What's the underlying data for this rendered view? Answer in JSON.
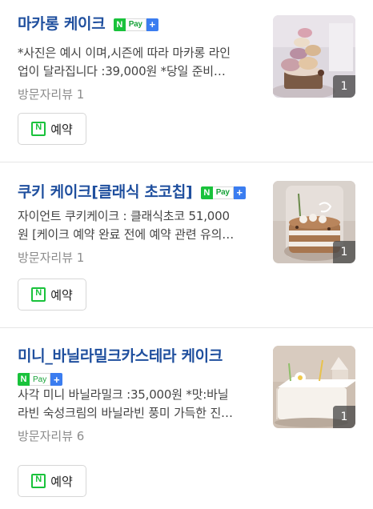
{
  "items": [
    {
      "title": "마카롱 케이크",
      "npay": {
        "n": "N",
        "pay": "Pay",
        "plus": "+"
      },
      "desc_line1": "*사진은 예시 이며,시즌에 따라 마카롱 라인",
      "desc_line2": "업이 달라집니다 :39,000원 *당일 준비…",
      "review": "방문자리뷰 1",
      "reserve_label": "예약",
      "reserve_icon_letter": "N",
      "image_count": "1"
    },
    {
      "title": "쿠키 케이크[클래식 초코칩]",
      "npay": {
        "n": "N",
        "pay": "Pay",
        "plus": "+"
      },
      "desc_line1": "자이언트 쿠키케이크 : 클래식초코 51,000",
      "desc_line2": "원 [케이크 예약 완료 전에 예약 관련 유의…",
      "review": "방문자리뷰 1",
      "reserve_label": "예약",
      "reserve_icon_letter": "N",
      "image_count": "1"
    },
    {
      "title": "미니_바닐라밀크카스테라 케이크",
      "npay": {
        "n": "N",
        "pay": "Pay",
        "plus": "+"
      },
      "desc_line1": "사각 미니 바닐라밀크 :35,000원 *맛:바닐",
      "desc_line2": "라빈 숙성크림의 바닐라빈 풍미 가득한 진…",
      "review": "방문자리뷰 6",
      "reserve_label": "예약",
      "reserve_icon_letter": "N",
      "image_count": "1"
    }
  ],
  "colors": {
    "title": "#1f4f9e",
    "npay_green": "#19c23b",
    "npay_blue": "#3b7df0",
    "meta_gray": "#8c8c8c"
  }
}
